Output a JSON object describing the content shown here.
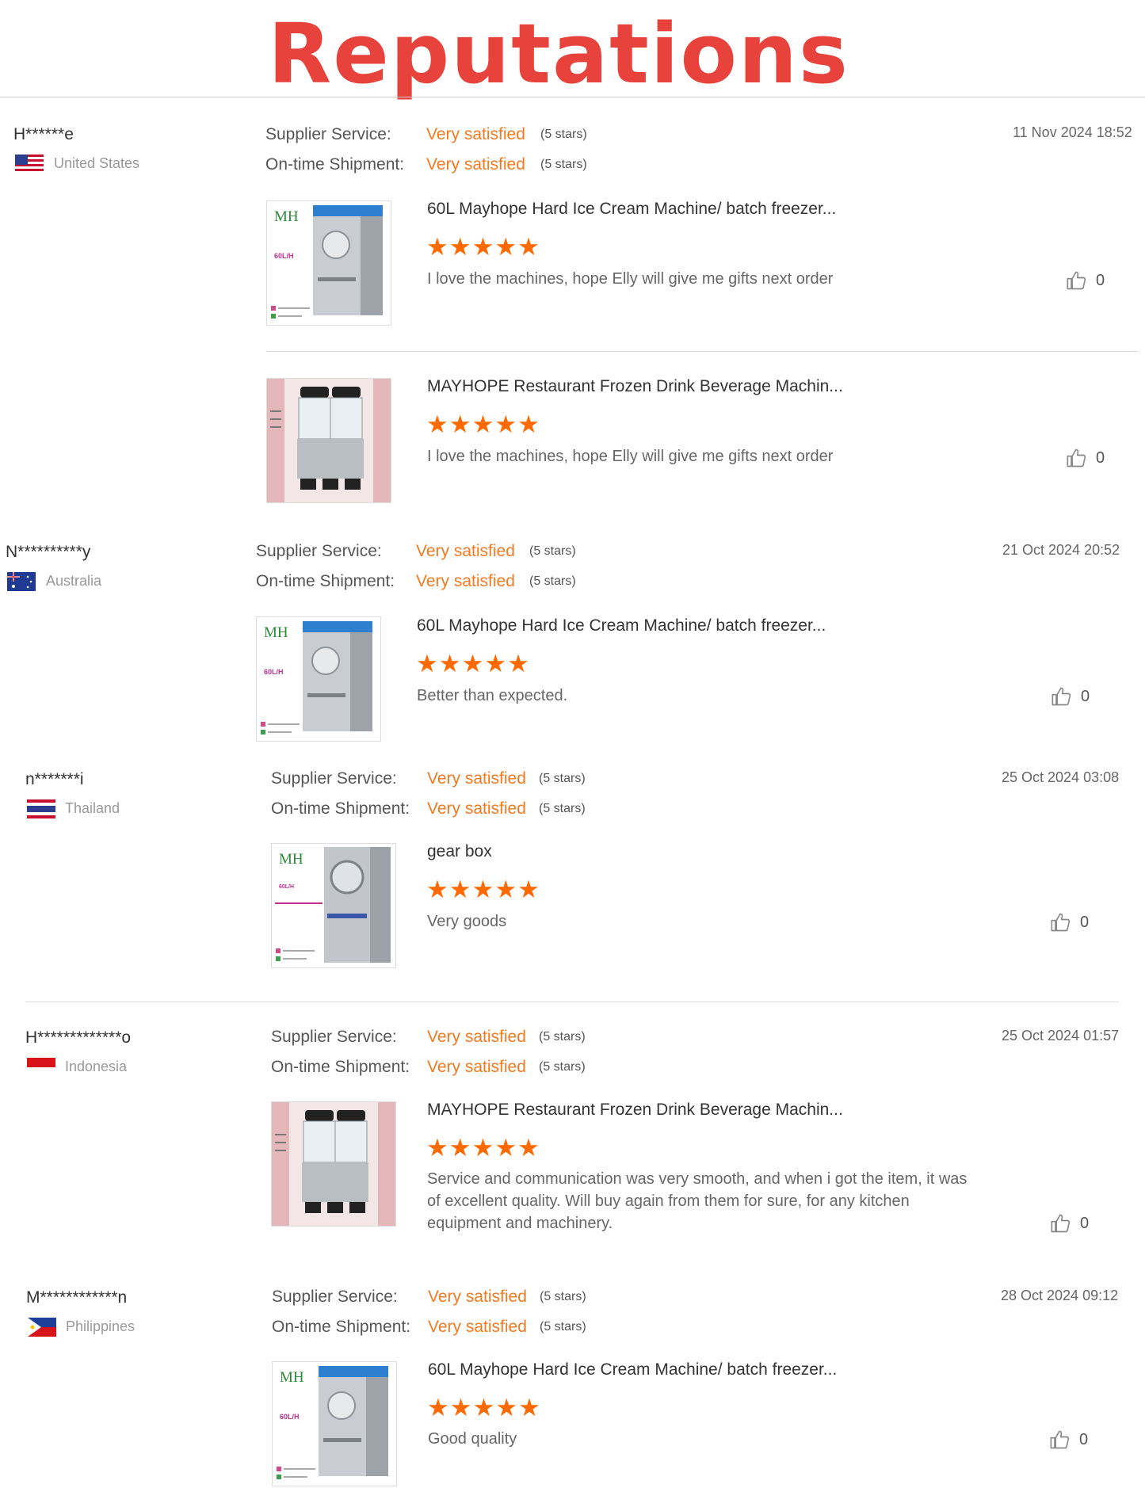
{
  "page_title": "Reputations",
  "labels": {
    "supplier_service": "Supplier Service:",
    "ontime_shipment": "On-time Shipment:"
  },
  "colors": {
    "title": "#e8423c",
    "accent": "#f47a20",
    "star": "#ff6a00"
  },
  "reviews": [
    {
      "name": "H******e",
      "country": "United States",
      "date": "11 Nov 2024 18:52",
      "supplier_value": "Very satisfied",
      "supplier_stars": "(5 stars)",
      "shipment_value": "Very satisfied",
      "shipment_stars": "(5 stars)",
      "items": [
        {
          "title": "60L Mayhope Hard Ice Cream Machine/ batch freezer...",
          "rating": 5,
          "rating_text": "★★★★★",
          "comment": "I love the machines, hope Elly will give me gifts next order",
          "likes": "0",
          "image": "ice-cream-machine"
        },
        {
          "title": "MAYHOPE Restaurant Frozen Drink Beverage Machin...",
          "rating": 5,
          "rating_text": "★★★★★",
          "comment": "I love the machines, hope Elly will give me gifts next order",
          "likes": "0",
          "image": "slush-machine"
        }
      ]
    },
    {
      "name": "N**********y",
      "country": "Australia",
      "date": "21 Oct 2024 20:52",
      "supplier_value": "Very satisfied",
      "supplier_stars": "(5 stars)",
      "shipment_value": "Very satisfied",
      "shipment_stars": "(5 stars)",
      "items": [
        {
          "title": "60L Mayhope Hard Ice Cream Machine/ batch freezer...",
          "rating": 5,
          "rating_text": "★★★★★",
          "comment": "Better than expected.",
          "likes": "0",
          "image": "ice-cream-machine"
        }
      ]
    },
    {
      "name": "n*******i",
      "country": "Thailand",
      "date": "25 Oct 2024 03:08",
      "supplier_value": "Very satisfied",
      "supplier_stars": "(5 stars)",
      "shipment_value": "Very satisfied",
      "shipment_stars": "(5 stars)",
      "items": [
        {
          "title": "gear box",
          "rating": 5,
          "rating_text": "★★★★★",
          "comment": "Very goods",
          "likes": "0",
          "image": "gelato-machine"
        }
      ]
    },
    {
      "name": "H*************o",
      "country": "Indonesia",
      "date": "25 Oct 2024 01:57",
      "supplier_value": "Very satisfied",
      "supplier_stars": "(5 stars)",
      "shipment_value": "Very satisfied",
      "shipment_stars": "(5 stars)",
      "items": [
        {
          "title": "MAYHOPE Restaurant Frozen Drink Beverage Machin...",
          "rating": 5,
          "rating_text": "★★★★★",
          "comment": "Service and communication was very smooth, and when i got the item, it was of excellent quality. Will buy again from them for sure, for any kitchen equipment and machinery.",
          "likes": "0",
          "image": "slush-machine"
        }
      ]
    },
    {
      "name": "M************n",
      "country": "Philippines",
      "date": "28 Oct 2024 09:12",
      "supplier_value": "Very satisfied",
      "supplier_stars": "(5 stars)",
      "shipment_value": "Very satisfied",
      "shipment_stars": "(5 stars)",
      "items": [
        {
          "title": "60L Mayhope Hard Ice Cream Machine/ batch freezer...",
          "rating": 5,
          "rating_text": "★★★★★",
          "comment": "Good quality",
          "likes": "0",
          "image": "ice-cream-machine"
        }
      ]
    }
  ],
  "thumb_text": {
    "brand": "MH",
    "capacity": "60L/H"
  }
}
